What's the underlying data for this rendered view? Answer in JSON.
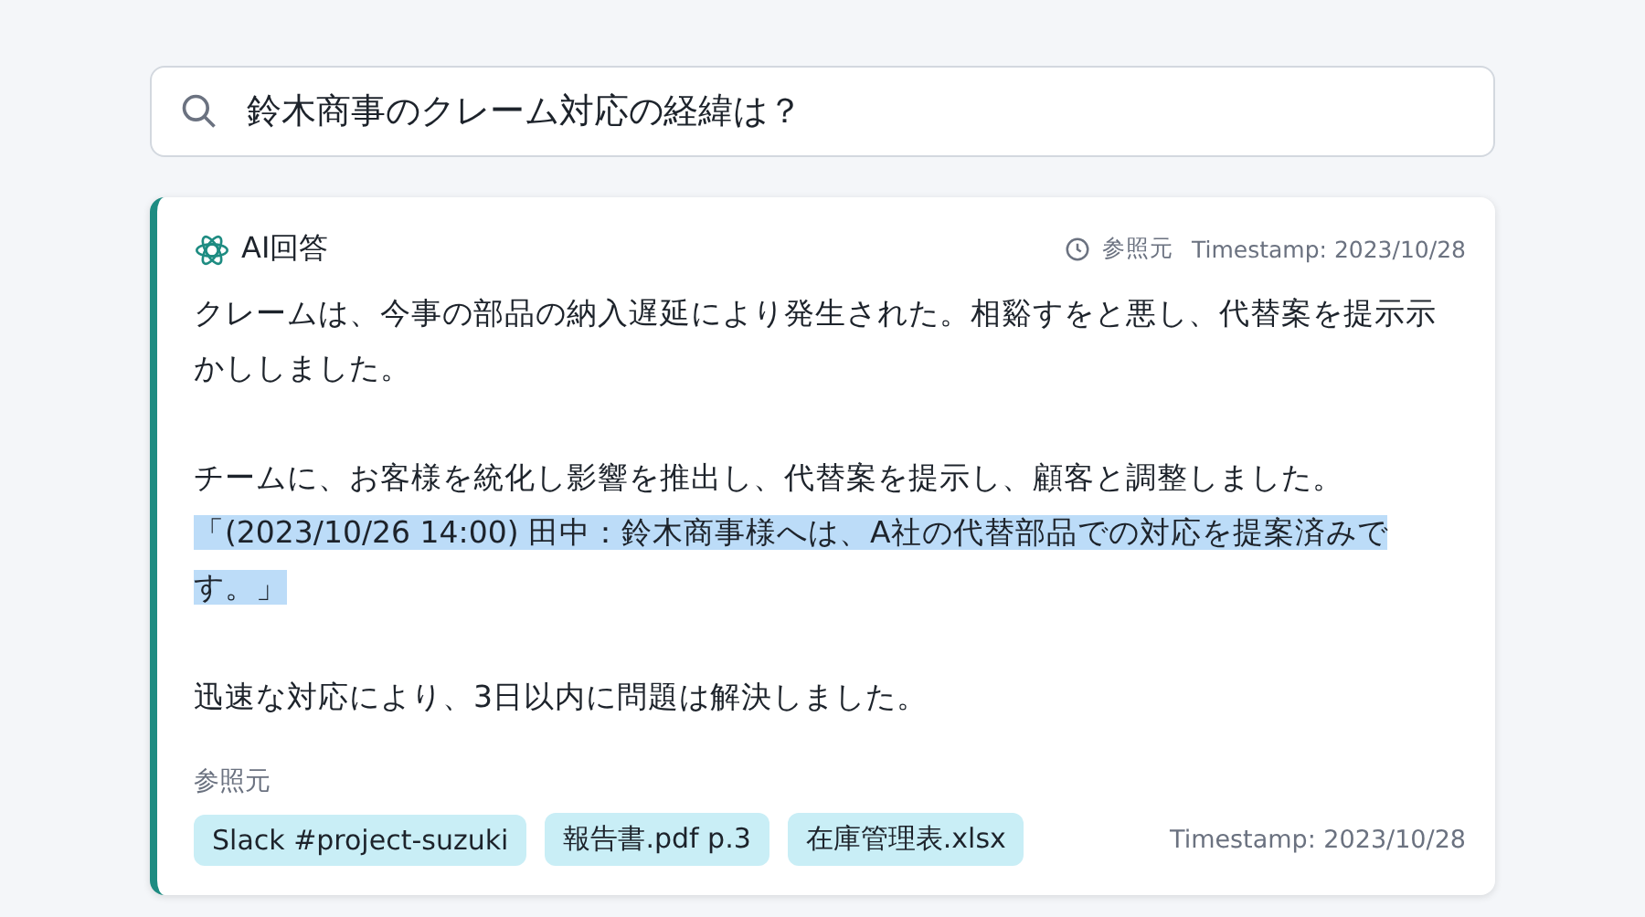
{
  "search": {
    "value": "鈴木商事のクレーム対応の経緯は？"
  },
  "answer": {
    "title": "AI回答",
    "source_label": "参照元",
    "timestamp": "Timestamp: 2023/10/28",
    "paragraphs": [
      [
        {
          "text": "クレームは、今事の部品の納入遅延により発生された。相谿すをと悪し、代替案を提示示かししました。",
          "highlighted": false
        }
      ],
      [
        {
          "text": "チームに、お客様を統化し影響を推出し、代替案を提示し、顧客と調整しました。",
          "highlighted": false
        },
        {
          "text": "「(2023/10/26 14:00) 田中：鈴木商事様へは、A社の代替部品での対応を提案済みです。」",
          "highlighted": true
        }
      ],
      [
        {
          "text": "迅速な対応により、3日以内に問題は解決しました。",
          "highlighted": false
        }
      ]
    ],
    "sources_heading": "参照元",
    "sources": [
      "Slack #project-suzuki",
      "報告書.pdf p.3",
      "在庫管理表.xlsx"
    ],
    "footer_timestamp": "Timestamp: 2023/10/28"
  }
}
